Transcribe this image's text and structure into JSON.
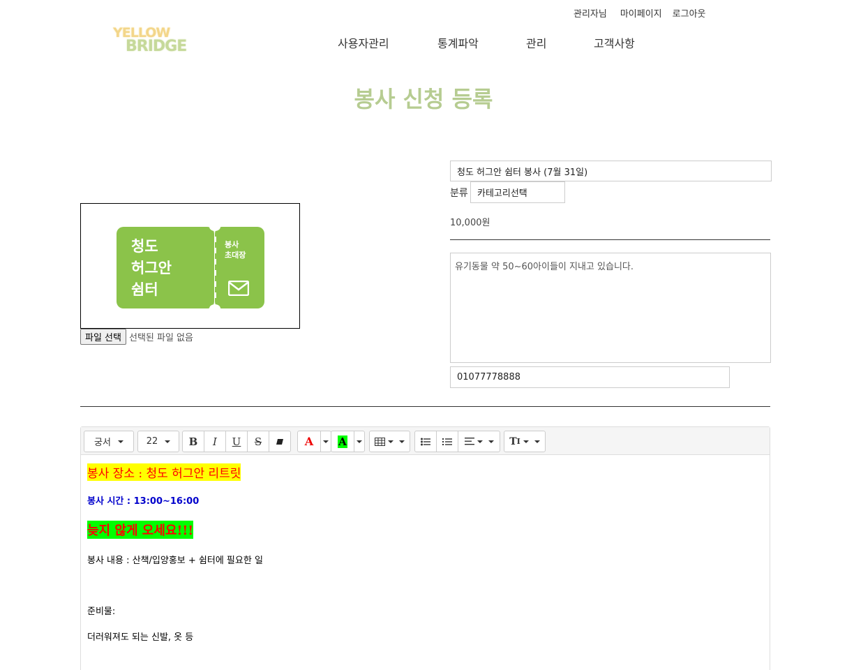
{
  "top_links": [
    "관리자님",
    "마이페이지",
    "로그아웃"
  ],
  "logo": {
    "line1": "YELLOW",
    "line2": "BRIDGE"
  },
  "nav": [
    "사용자관리",
    "통계파악",
    "관리",
    "고객사항"
  ],
  "page_title": "봉사 신청 등록",
  "image": {
    "ticket_big_text": [
      "청도",
      "허그안",
      "쉼터"
    ],
    "ticket_small_text": [
      "봉사",
      "초대장"
    ],
    "file_button": "파일 선택",
    "file_status": "선택된 파일 없음"
  },
  "form": {
    "title_value": "청도 허그안 쉼터 봉사 (7월 31일)",
    "category_label": "분류",
    "category_select": "카테고리선택",
    "price": "10,000원",
    "description": "유기동물 약 50~60아이들이 지내고 있습니다.",
    "phone": "01077778888"
  },
  "editor": {
    "font_select": "궁서",
    "size_select": "22",
    "content": {
      "line1": "봉사 장소 : 청도 허그안 리트릿",
      "line2": "봉사 시간 : 13:00~16:00",
      "line3": "늦지 않게 오세요!!!",
      "line4": "봉사 내용 : 산책/입양홍보 + 쉼터에 필요한 일",
      "line5": "준비물:",
      "line6": "더러워져도 되는 신발, 옷 등"
    }
  }
}
